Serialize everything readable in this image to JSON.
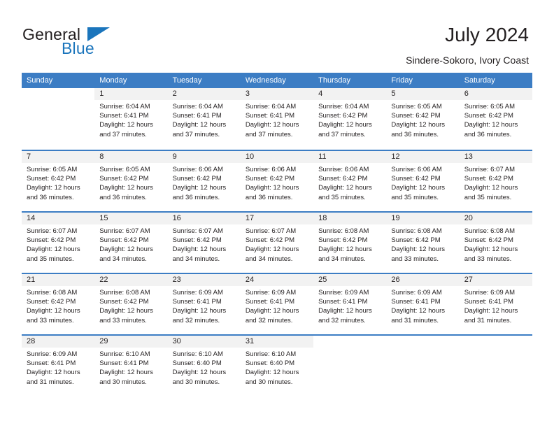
{
  "brand": {
    "name_part1": "General",
    "name_part2": "Blue",
    "logo_icon": "triangle-icon"
  },
  "header": {
    "title": "July 2024",
    "subtitle": "Sindere-Sokoro, Ivory Coast"
  },
  "colors": {
    "header_blue": "#3c7dc4",
    "brand_blue": "#1b75bc",
    "daynum_band": "#f2f2f2",
    "text": "#231f20"
  },
  "calendar": {
    "weekdays": [
      "Sunday",
      "Monday",
      "Tuesday",
      "Wednesday",
      "Thursday",
      "Friday",
      "Saturday"
    ],
    "weeks": [
      [
        {
          "day": "",
          "sunrise": "",
          "sunset": "",
          "daylight_line1": "",
          "daylight_line2": ""
        },
        {
          "day": "1",
          "sunrise": "Sunrise: 6:04 AM",
          "sunset": "Sunset: 6:41 PM",
          "daylight_line1": "Daylight: 12 hours",
          "daylight_line2": "and 37 minutes."
        },
        {
          "day": "2",
          "sunrise": "Sunrise: 6:04 AM",
          "sunset": "Sunset: 6:41 PM",
          "daylight_line1": "Daylight: 12 hours",
          "daylight_line2": "and 37 minutes."
        },
        {
          "day": "3",
          "sunrise": "Sunrise: 6:04 AM",
          "sunset": "Sunset: 6:41 PM",
          "daylight_line1": "Daylight: 12 hours",
          "daylight_line2": "and 37 minutes."
        },
        {
          "day": "4",
          "sunrise": "Sunrise: 6:04 AM",
          "sunset": "Sunset: 6:42 PM",
          "daylight_line1": "Daylight: 12 hours",
          "daylight_line2": "and 37 minutes."
        },
        {
          "day": "5",
          "sunrise": "Sunrise: 6:05 AM",
          "sunset": "Sunset: 6:42 PM",
          "daylight_line1": "Daylight: 12 hours",
          "daylight_line2": "and 36 minutes."
        },
        {
          "day": "6",
          "sunrise": "Sunrise: 6:05 AM",
          "sunset": "Sunset: 6:42 PM",
          "daylight_line1": "Daylight: 12 hours",
          "daylight_line2": "and 36 minutes."
        }
      ],
      [
        {
          "day": "7",
          "sunrise": "Sunrise: 6:05 AM",
          "sunset": "Sunset: 6:42 PM",
          "daylight_line1": "Daylight: 12 hours",
          "daylight_line2": "and 36 minutes."
        },
        {
          "day": "8",
          "sunrise": "Sunrise: 6:05 AM",
          "sunset": "Sunset: 6:42 PM",
          "daylight_line1": "Daylight: 12 hours",
          "daylight_line2": "and 36 minutes."
        },
        {
          "day": "9",
          "sunrise": "Sunrise: 6:06 AM",
          "sunset": "Sunset: 6:42 PM",
          "daylight_line1": "Daylight: 12 hours",
          "daylight_line2": "and 36 minutes."
        },
        {
          "day": "10",
          "sunrise": "Sunrise: 6:06 AM",
          "sunset": "Sunset: 6:42 PM",
          "daylight_line1": "Daylight: 12 hours",
          "daylight_line2": "and 36 minutes."
        },
        {
          "day": "11",
          "sunrise": "Sunrise: 6:06 AM",
          "sunset": "Sunset: 6:42 PM",
          "daylight_line1": "Daylight: 12 hours",
          "daylight_line2": "and 35 minutes."
        },
        {
          "day": "12",
          "sunrise": "Sunrise: 6:06 AM",
          "sunset": "Sunset: 6:42 PM",
          "daylight_line1": "Daylight: 12 hours",
          "daylight_line2": "and 35 minutes."
        },
        {
          "day": "13",
          "sunrise": "Sunrise: 6:07 AM",
          "sunset": "Sunset: 6:42 PM",
          "daylight_line1": "Daylight: 12 hours",
          "daylight_line2": "and 35 minutes."
        }
      ],
      [
        {
          "day": "14",
          "sunrise": "Sunrise: 6:07 AM",
          "sunset": "Sunset: 6:42 PM",
          "daylight_line1": "Daylight: 12 hours",
          "daylight_line2": "and 35 minutes."
        },
        {
          "day": "15",
          "sunrise": "Sunrise: 6:07 AM",
          "sunset": "Sunset: 6:42 PM",
          "daylight_line1": "Daylight: 12 hours",
          "daylight_line2": "and 34 minutes."
        },
        {
          "day": "16",
          "sunrise": "Sunrise: 6:07 AM",
          "sunset": "Sunset: 6:42 PM",
          "daylight_line1": "Daylight: 12 hours",
          "daylight_line2": "and 34 minutes."
        },
        {
          "day": "17",
          "sunrise": "Sunrise: 6:07 AM",
          "sunset": "Sunset: 6:42 PM",
          "daylight_line1": "Daylight: 12 hours",
          "daylight_line2": "and 34 minutes."
        },
        {
          "day": "18",
          "sunrise": "Sunrise: 6:08 AM",
          "sunset": "Sunset: 6:42 PM",
          "daylight_line1": "Daylight: 12 hours",
          "daylight_line2": "and 34 minutes."
        },
        {
          "day": "19",
          "sunrise": "Sunrise: 6:08 AM",
          "sunset": "Sunset: 6:42 PM",
          "daylight_line1": "Daylight: 12 hours",
          "daylight_line2": "and 33 minutes."
        },
        {
          "day": "20",
          "sunrise": "Sunrise: 6:08 AM",
          "sunset": "Sunset: 6:42 PM",
          "daylight_line1": "Daylight: 12 hours",
          "daylight_line2": "and 33 minutes."
        }
      ],
      [
        {
          "day": "21",
          "sunrise": "Sunrise: 6:08 AM",
          "sunset": "Sunset: 6:42 PM",
          "daylight_line1": "Daylight: 12 hours",
          "daylight_line2": "and 33 minutes."
        },
        {
          "day": "22",
          "sunrise": "Sunrise: 6:08 AM",
          "sunset": "Sunset: 6:42 PM",
          "daylight_line1": "Daylight: 12 hours",
          "daylight_line2": "and 33 minutes."
        },
        {
          "day": "23",
          "sunrise": "Sunrise: 6:09 AM",
          "sunset": "Sunset: 6:41 PM",
          "daylight_line1": "Daylight: 12 hours",
          "daylight_line2": "and 32 minutes."
        },
        {
          "day": "24",
          "sunrise": "Sunrise: 6:09 AM",
          "sunset": "Sunset: 6:41 PM",
          "daylight_line1": "Daylight: 12 hours",
          "daylight_line2": "and 32 minutes."
        },
        {
          "day": "25",
          "sunrise": "Sunrise: 6:09 AM",
          "sunset": "Sunset: 6:41 PM",
          "daylight_line1": "Daylight: 12 hours",
          "daylight_line2": "and 32 minutes."
        },
        {
          "day": "26",
          "sunrise": "Sunrise: 6:09 AM",
          "sunset": "Sunset: 6:41 PM",
          "daylight_line1": "Daylight: 12 hours",
          "daylight_line2": "and 31 minutes."
        },
        {
          "day": "27",
          "sunrise": "Sunrise: 6:09 AM",
          "sunset": "Sunset: 6:41 PM",
          "daylight_line1": "Daylight: 12 hours",
          "daylight_line2": "and 31 minutes."
        }
      ],
      [
        {
          "day": "28",
          "sunrise": "Sunrise: 6:09 AM",
          "sunset": "Sunset: 6:41 PM",
          "daylight_line1": "Daylight: 12 hours",
          "daylight_line2": "and 31 minutes."
        },
        {
          "day": "29",
          "sunrise": "Sunrise: 6:10 AM",
          "sunset": "Sunset: 6:41 PM",
          "daylight_line1": "Daylight: 12 hours",
          "daylight_line2": "and 30 minutes."
        },
        {
          "day": "30",
          "sunrise": "Sunrise: 6:10 AM",
          "sunset": "Sunset: 6:40 PM",
          "daylight_line1": "Daylight: 12 hours",
          "daylight_line2": "and 30 minutes."
        },
        {
          "day": "31",
          "sunrise": "Sunrise: 6:10 AM",
          "sunset": "Sunset: 6:40 PM",
          "daylight_line1": "Daylight: 12 hours",
          "daylight_line2": "and 30 minutes."
        },
        {
          "day": "",
          "sunrise": "",
          "sunset": "",
          "daylight_line1": "",
          "daylight_line2": ""
        },
        {
          "day": "",
          "sunrise": "",
          "sunset": "",
          "daylight_line1": "",
          "daylight_line2": ""
        },
        {
          "day": "",
          "sunrise": "",
          "sunset": "",
          "daylight_line1": "",
          "daylight_line2": ""
        }
      ]
    ]
  }
}
